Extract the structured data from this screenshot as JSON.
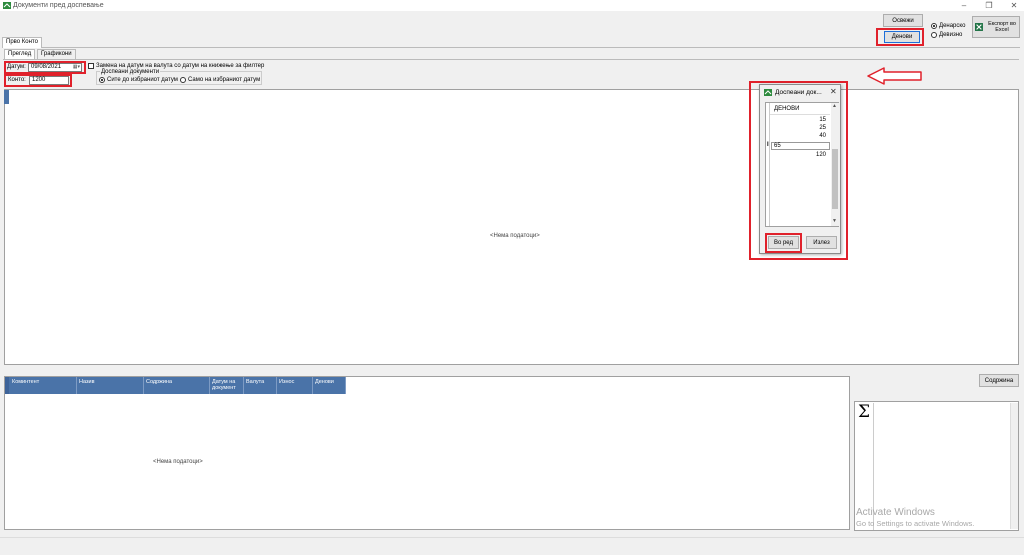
{
  "window": {
    "title": "Документи пред доспевање",
    "minimize": "–",
    "restore": "❐",
    "close": "✕"
  },
  "toolbar": {
    "refresh_label": "Освежи",
    "days_label": "Денови",
    "currency_denar": "Денарско",
    "currency_foreign": "Девизно",
    "export_label": "Експорт во Excel"
  },
  "tabs": {
    "outer": "Прво Конто",
    "inner": [
      "Преглед",
      "Графикони"
    ]
  },
  "filters": {
    "date_label": "Датум:",
    "date_value": "09/08/2021",
    "konto_label": "Конто:",
    "konto_value": "1200",
    "replace_checkbox": "Замена на датум на валута со датум на книжење за филтер",
    "due_docs_label": "Доспеани документи",
    "option_all": "Сите до избраниот датум",
    "option_only": "Само на избраниот датум"
  },
  "main_grid": {
    "empty_text": "<Нема податоци>"
  },
  "bottom_grid": {
    "columns": [
      "Коминтент",
      "Назив",
      "Содржина",
      "Датум на документ",
      "Валута",
      "Износ",
      "Денови"
    ],
    "empty_text": "<Нема податоци>"
  },
  "content_button": "Содржина",
  "sigma": "Σ",
  "dialog": {
    "title": "Доспеани док...",
    "header": "ДЕНОВИ",
    "rows": [
      "15",
      "25",
      "40",
      "65",
      "120"
    ],
    "ok_label": "Во ред",
    "exit_label": "Излез"
  },
  "watermark": {
    "line1": "Activate Windows",
    "line2": "Go to Settings to activate Windows."
  },
  "colors": {
    "accent_red": "#e0212b",
    "grid_header": "#4a73a8",
    "focus_blue": "#1e6fd9"
  }
}
